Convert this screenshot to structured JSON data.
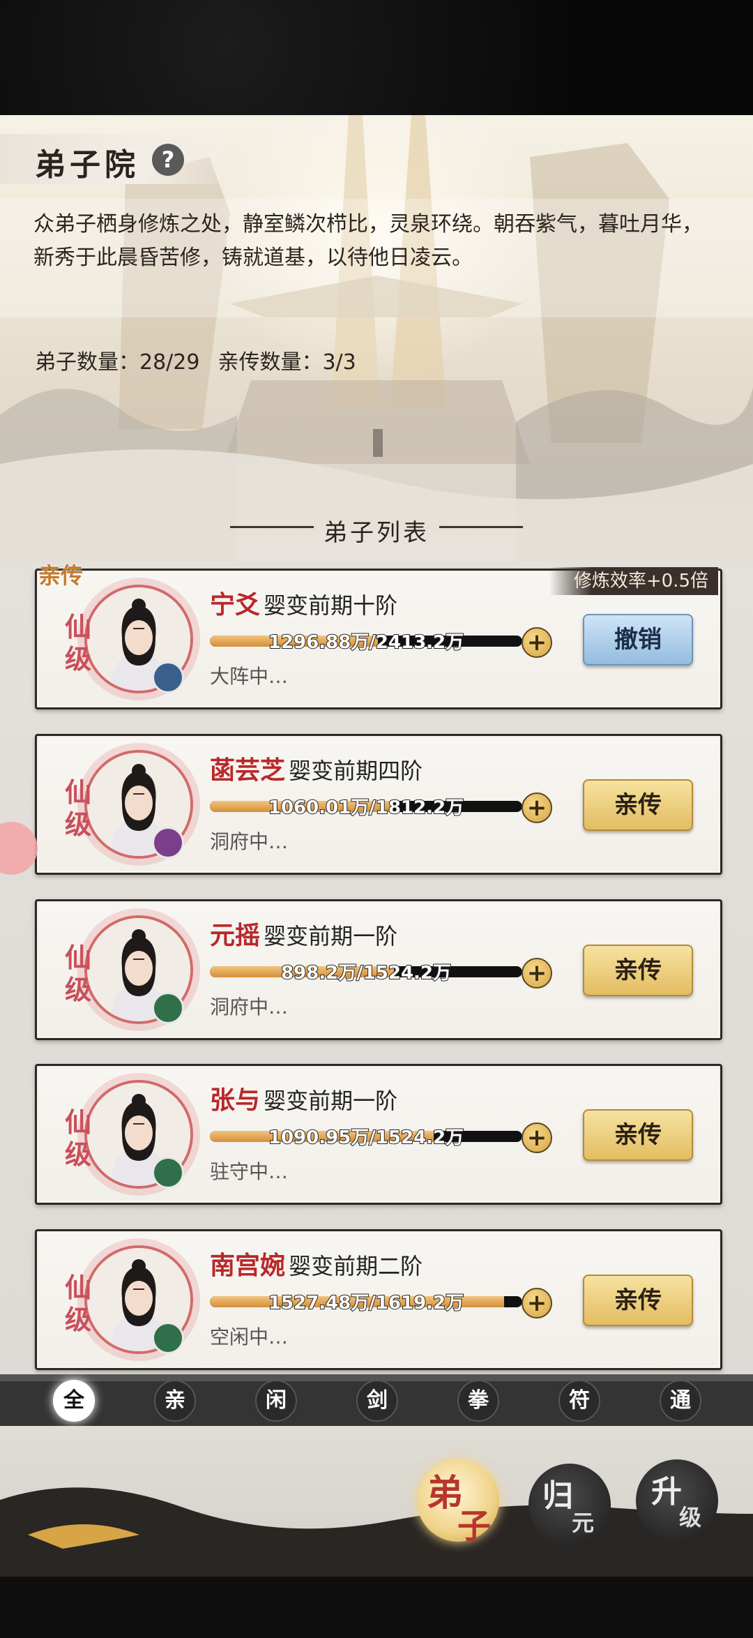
{
  "header": {
    "title": "弟子院",
    "help": "?",
    "description": "众弟子栖身修炼之处，静室鳞次栉比，灵泉环绕。朝吞紫气，暮吐月华，新秀于此晨昏苦修，铸就道基，以待他日凌云。",
    "disciple_count": "弟子数量：28/29",
    "direct_count": "亲传数量：3/3"
  },
  "list": {
    "title": "弟子列表",
    "direct_badge": "亲传",
    "efficiency_badge": "修炼效率+0.5倍",
    "items": [
      {
        "rank": "仙级",
        "name": "宁爻",
        "stage": "婴变前期十阶",
        "progress_text": "1296.88万/2413.2万",
        "progress": 0.537,
        "status": "大阵中…",
        "action": "撤销",
        "element": "ice"
      },
      {
        "rank": "仙级",
        "name": "菡芸芝",
        "stage": "婴变前期四阶",
        "progress_text": "1060.01万/1812.2万",
        "progress": 0.585,
        "status": "洞府中…",
        "action": "亲传",
        "element": "flame"
      },
      {
        "rank": "仙级",
        "name": "元摇",
        "stage": "婴变前期一阶",
        "progress_text": "898.2万/1524.2万",
        "progress": 0.589,
        "status": "洞府中…",
        "action": "亲传",
        "element": "wind"
      },
      {
        "rank": "仙级",
        "name": "张与",
        "stage": "婴变前期一阶",
        "progress_text": "1090.95万/1524.2万",
        "progress": 0.716,
        "status": "驻守中…",
        "action": "亲传",
        "element": "wind"
      },
      {
        "rank": "仙级",
        "name": "南宫婉",
        "stage": "婴变前期二阶",
        "progress_text": "1527.48万/1619.2万",
        "progress": 0.943,
        "status": "空闲中…",
        "action": "亲传",
        "element": "wind"
      }
    ]
  },
  "filters": [
    "全",
    "亲",
    "闲",
    "剑",
    "拳",
    "符",
    "通"
  ],
  "nav": {
    "disciple": [
      "弟",
      "子"
    ],
    "return": [
      "归",
      "元"
    ],
    "upgrade": [
      "升",
      "级"
    ]
  },
  "colors": {
    "name_red": "#b8282a",
    "rank_pink": "#c94f5a",
    "gold_button": "#e3bd62",
    "blue_button": "#93bde0"
  }
}
